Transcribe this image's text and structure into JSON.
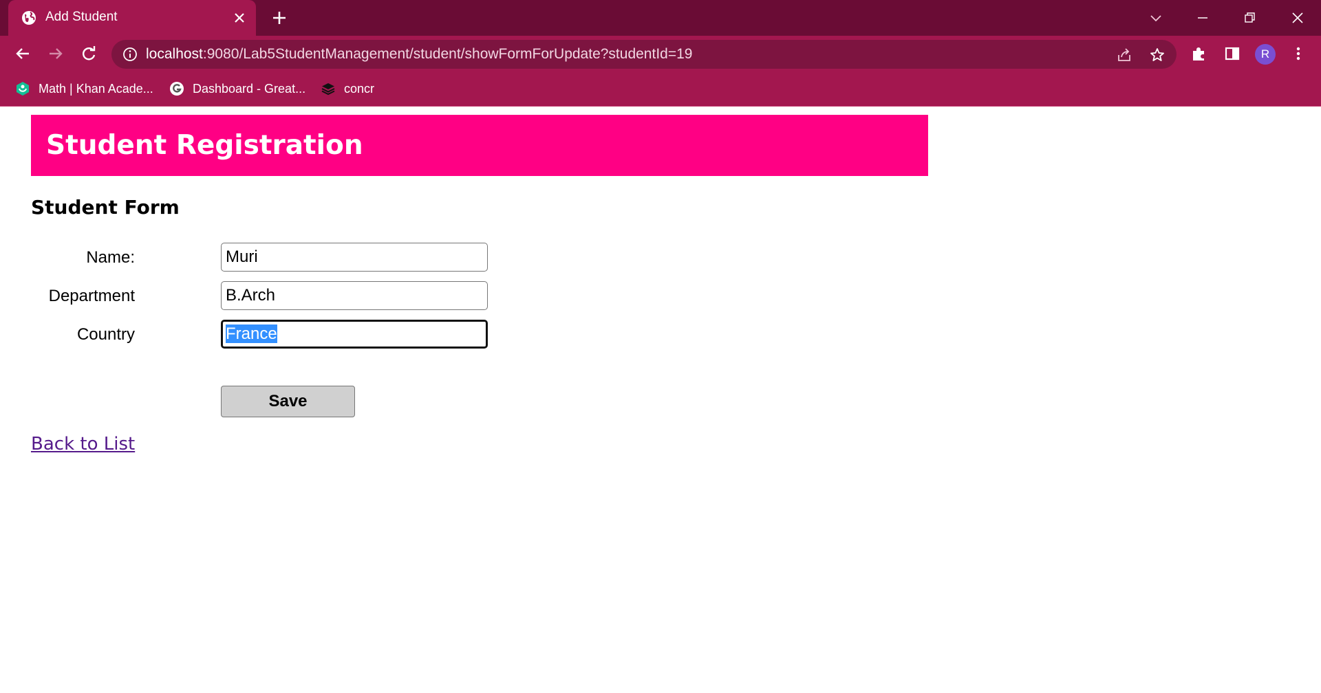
{
  "browser": {
    "tab": {
      "title": "Add Student",
      "icon": "globe-icon"
    },
    "url": {
      "host": "localhost",
      "rest": ":9080/Lab5StudentManagement/student/showFormForUpdate?studentId=19"
    },
    "profile_initial": "R",
    "bookmarks": [
      {
        "label": "Math | Khan Acade...",
        "icon": "khan-academy-icon"
      },
      {
        "label": "Dashboard - Great...",
        "icon": "great-learning-icon"
      },
      {
        "label": "concr",
        "icon": "stack-icon"
      }
    ],
    "colors": {
      "tabbar": "#6a0c35",
      "toolbar": "#a3174f",
      "omnibox": "#7d1440"
    }
  },
  "page": {
    "header_title": "Student Registration",
    "form_title": "Student Form",
    "fields": [
      {
        "label": "Name:",
        "value": "Muri"
      },
      {
        "label": "Department",
        "value": "B.Arch"
      },
      {
        "label": "Country",
        "value": "France",
        "focused": true,
        "selected": true
      }
    ],
    "save_label": "Save",
    "back_link": "Back to List",
    "colors": {
      "header": "#ff0084",
      "link": "#551a8b",
      "selection": "#3390ff"
    }
  }
}
